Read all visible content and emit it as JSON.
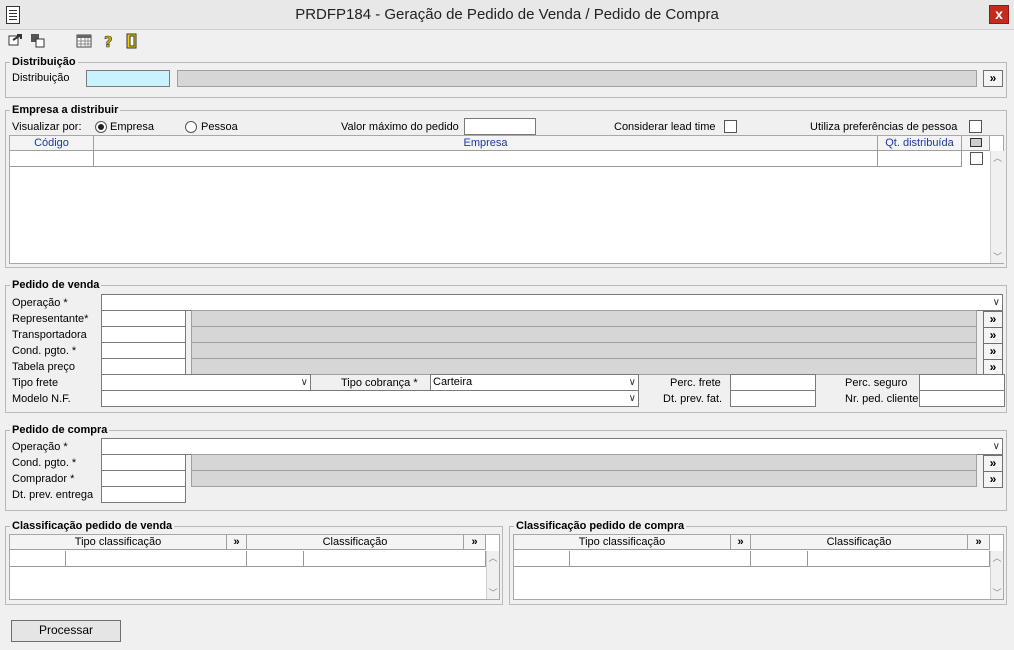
{
  "window": {
    "title": "PRDFP184 - Geração de Pedido de Venda / Pedido de Compra",
    "close_label": "x"
  },
  "toolbar": {
    "icons": [
      "export-icon",
      "copy-icon",
      "calendar-icon",
      "help-icon",
      "exit-icon"
    ]
  },
  "distribuicao": {
    "group_title": "Distribuição",
    "label": "Distribuição",
    "value": "",
    "lookup_label": "»"
  },
  "empresa": {
    "group_title": "Empresa a distribuir",
    "visualizar_label": "Visualizar por:",
    "radio_empresa": "Empresa",
    "radio_pessoa": "Pessoa",
    "radio_selected": "Empresa",
    "valor_maximo_label": "Valor máximo do pedido",
    "valor_maximo_value": "",
    "lead_time_label": "Considerar lead time",
    "preferencias_label": "Utiliza preferências de pessoa",
    "columns": [
      "Código",
      "Empresa",
      "Qt. distribuída"
    ]
  },
  "venda": {
    "group_title": "Pedido de venda",
    "operacao_label": "Operação *",
    "representante_label": "Representante*",
    "transportadora_label": "Transportadora",
    "cond_pgto_label": "Cond. pgto. *",
    "tabela_preco_label": "Tabela preço",
    "tipo_frete_label": "Tipo frete",
    "tipo_cobranca_label": "Tipo cobrança *",
    "tipo_cobranca_value": "Carteira",
    "perc_frete_label": "Perc. frete",
    "perc_seguro_label": "Perc. seguro",
    "modelo_nf_label": "Modelo N.F.",
    "dt_prev_fat_label": "Dt. prev. fat.",
    "nr_ped_cliente_label": "Nr. ped. cliente",
    "lookup_label": "»"
  },
  "compra": {
    "group_title": "Pedido de compra",
    "operacao_label": "Operação *",
    "cond_pgto_label": "Cond. pgto. *",
    "comprador_label": "Comprador *",
    "dt_prev_entrega_label": "Dt. prev. entrega",
    "lookup_label": "»"
  },
  "class_venda": {
    "group_title": "Classificação pedido de venda",
    "col_tipo": "Tipo classificação",
    "col_class": "Classificação",
    "lookup_label": "»"
  },
  "class_compra": {
    "group_title": "Classificação pedido de compra",
    "col_tipo": "Tipo classificação",
    "col_class": "Classificação",
    "lookup_label": "»"
  },
  "actions": {
    "processar_label": "Processar"
  }
}
